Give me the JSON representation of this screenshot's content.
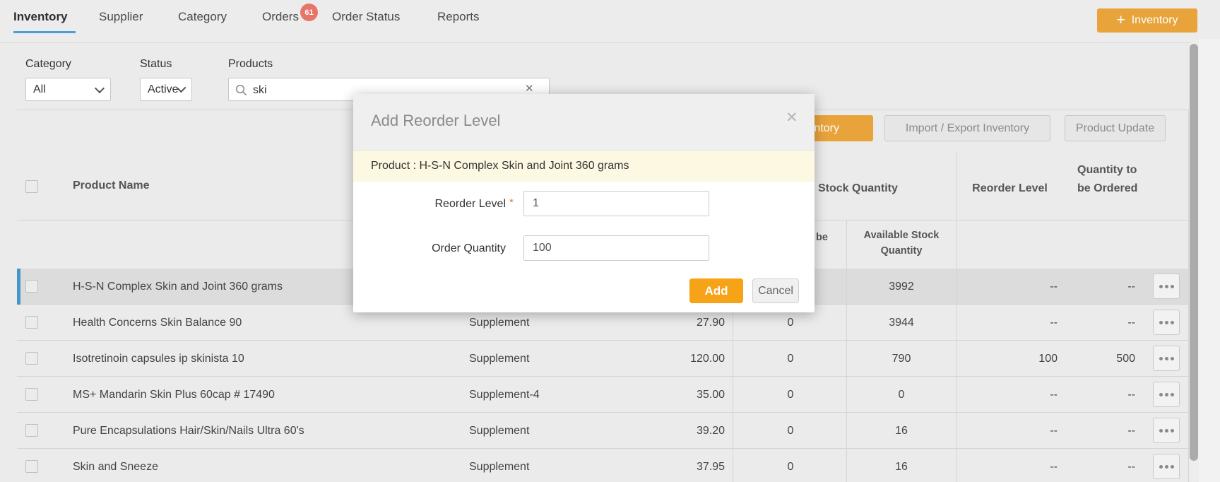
{
  "nav": {
    "tabs": [
      {
        "label": "Inventory",
        "active": true
      },
      {
        "label": "Supplier",
        "active": false
      },
      {
        "label": "Category",
        "active": false
      },
      {
        "label": "Orders",
        "active": false,
        "badge": "61"
      },
      {
        "label": "Order Status",
        "active": false
      },
      {
        "label": "Reports",
        "active": false
      }
    ],
    "add_button": {
      "plus": "+",
      "label": "Inventory"
    }
  },
  "filters": {
    "category_label": "Category",
    "category_value": "All",
    "status_label": "Status",
    "status_value": "Active",
    "products_label": "Products",
    "search_value": "ski",
    "clear_icon": "✕"
  },
  "toolbar": {
    "hidden_orange_label": "ventory",
    "import_export_label": "Import / Export Inventory",
    "product_update_label": "Product Update"
  },
  "table": {
    "headers": {
      "product_name": "Product Name",
      "stock_quantity": "Stock Quantity",
      "reorder_level": "Reorder Level",
      "qty_to_be_ordered": "Quantity to be Ordered"
    },
    "subheaders": {
      "qty_to_be_fragment": "be",
      "available_stock": "Available Stock Quantity"
    },
    "rows": [
      {
        "name": "H-S-N Complex Skin and Joint 360 grams",
        "category": "",
        "price": "",
        "qty_to_be": "",
        "available": "3992",
        "reorder": "--",
        "ordered": "--"
      },
      {
        "name": "Health Concerns Skin Balance 90",
        "category": "Supplement",
        "price": "27.90",
        "qty_to_be": "0",
        "available": "3944",
        "reorder": "--",
        "ordered": "--"
      },
      {
        "name": "Isotretinoin capsules ip skinista 10",
        "category": "Supplement",
        "price": "120.00",
        "qty_to_be": "0",
        "available": "790",
        "reorder": "100",
        "ordered": "500"
      },
      {
        "name": "MS+ Mandarin Skin Plus 60cap # 17490",
        "category": "Supplement-4",
        "price": "35.00",
        "qty_to_be": "0",
        "available": "0",
        "reorder": "--",
        "ordered": "--"
      },
      {
        "name": "Pure Encapsulations Hair/Skin/Nails Ultra 60's",
        "category": "Supplement",
        "price": "39.20",
        "qty_to_be": "0",
        "available": "16",
        "reorder": "--",
        "ordered": "--"
      },
      {
        "name": "Skin and Sneeze",
        "category": "Supplement",
        "price": "37.95",
        "qty_to_be": "0",
        "available": "16",
        "reorder": "--",
        "ordered": "--"
      }
    ]
  },
  "modal": {
    "title": "Add Reorder Level",
    "close_icon": "✕",
    "product_line": "Product : H-S-N Complex Skin and Joint 360 grams",
    "reorder_label": "Reorder Level",
    "required_mark": "*",
    "reorder_value": "1",
    "order_qty_label": "Order Quantity",
    "order_qty_value": "100",
    "add_label": "Add",
    "cancel_label": "Cancel"
  },
  "colors": {
    "accent_amber": "#e9a33b",
    "add_button_orange": "#f6a318",
    "active_tab_blue": "#4aa0d6",
    "badge_red": "#e8756a",
    "selected_row_bar_blue": "#4596c8",
    "modal_band_yellow": "#fcf8e1"
  }
}
